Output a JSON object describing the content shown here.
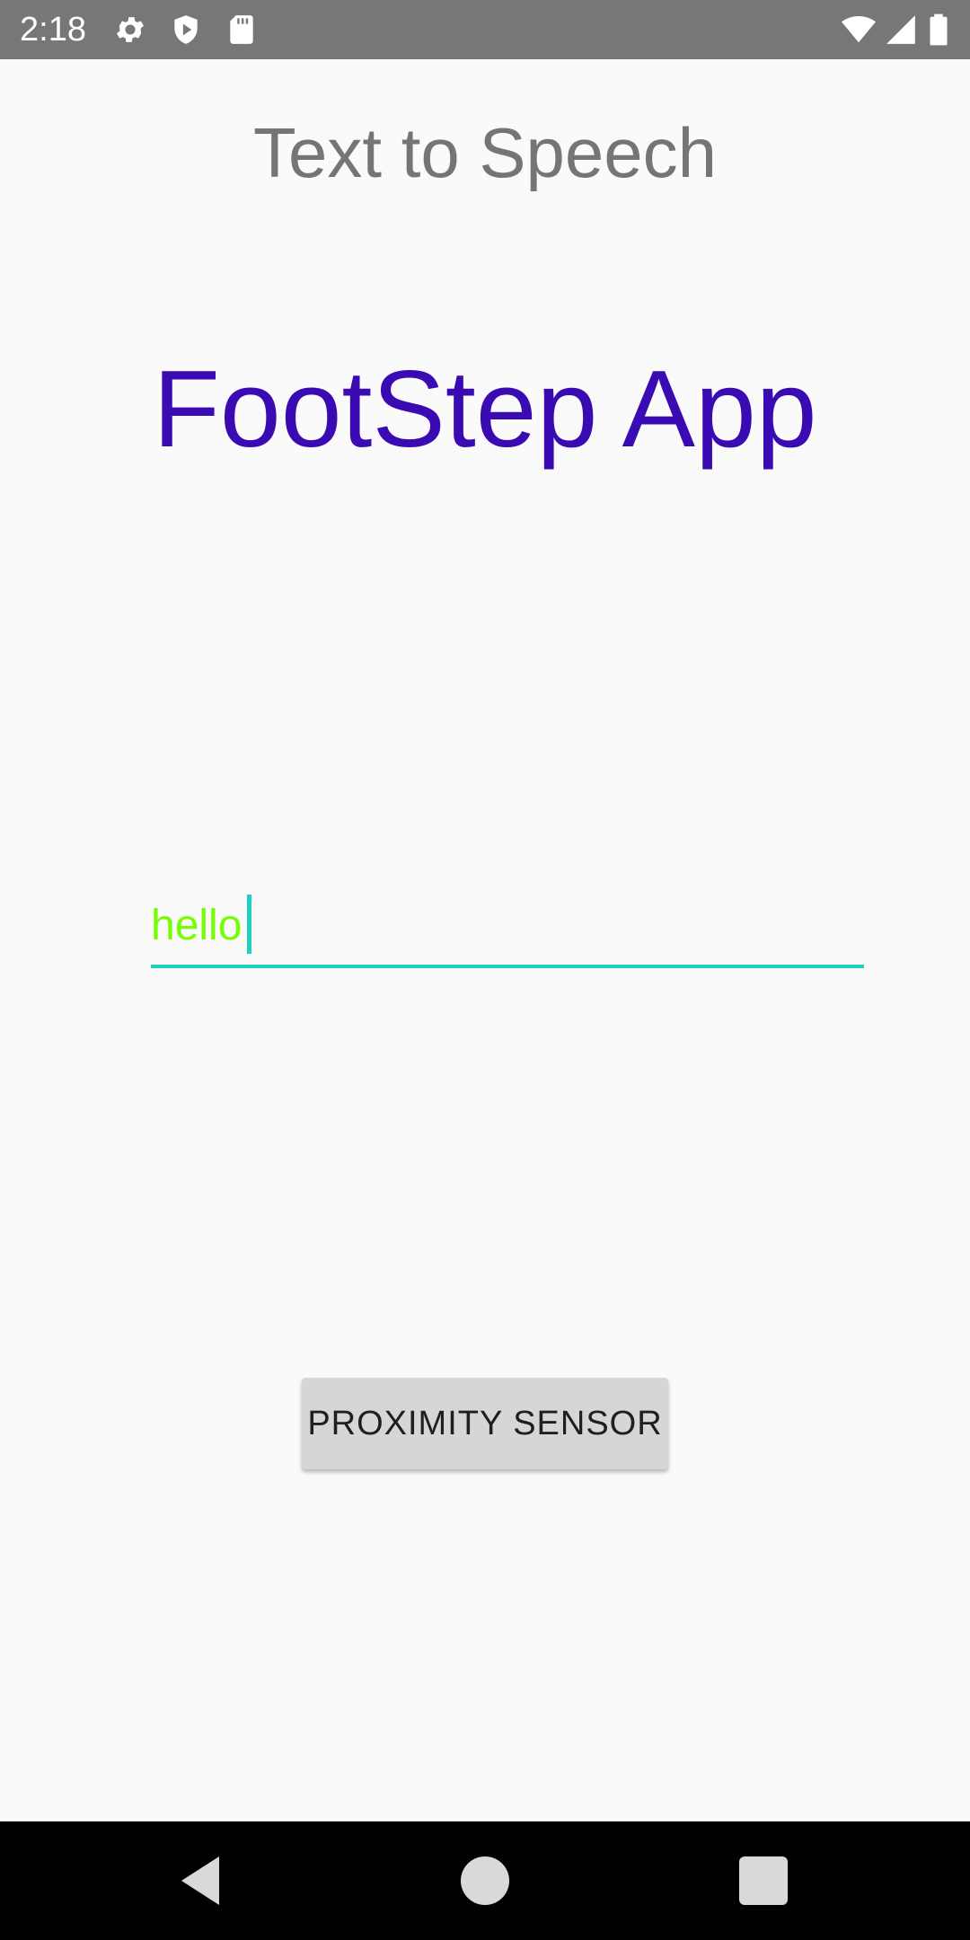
{
  "status_bar": {
    "time": "2:18",
    "left_icons": [
      "gear-icon",
      "shield-icon",
      "sd-card-icon"
    ],
    "right_icons": [
      "wifi-icon",
      "signal-icon",
      "battery-icon"
    ],
    "background": "#777777"
  },
  "app": {
    "title": "Text to Speech",
    "heading": "FootStep App",
    "heading_color": "#3a0ab2"
  },
  "input": {
    "value": "hello",
    "text_color": "#76ff03",
    "underline_color": "#1ecfc4"
  },
  "button": {
    "label": "PROXIMITY SENSOR"
  },
  "nav_bar": {
    "buttons": [
      "back-icon",
      "home-icon",
      "recents-icon"
    ]
  }
}
